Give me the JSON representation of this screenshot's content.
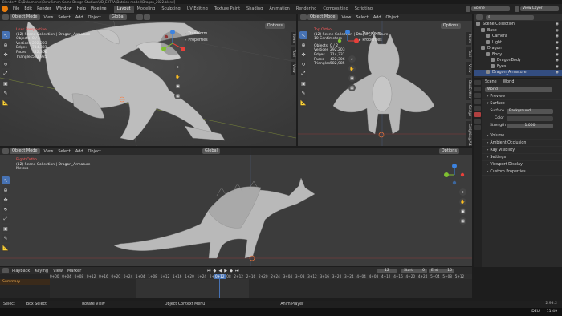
{
  "titlebar": {
    "title": "Blender* [E:\\Dokumente\\Beruflichen Game Design Studium\\3D_EXTRA\\Dateien modell\\Dragon_2022.blend]"
  },
  "topbar": {
    "menus": [
      "File",
      "Edit",
      "Render",
      "Window",
      "Help"
    ],
    "pipeline": "Pipeline",
    "workspaces": [
      "Layout",
      "Modeling",
      "Sculpting",
      "UV Editing",
      "Texture Paint",
      "Shading",
      "Animation",
      "Rendering",
      "Compositing",
      "Scripting"
    ],
    "active_workspace": "Layout",
    "scene_label": "Scene",
    "viewlayer_label": "View Layer"
  },
  "vp_top_left": {
    "mode": "Object Mode",
    "menus": [
      "View",
      "Select",
      "Add",
      "Object"
    ],
    "orientation": "Global",
    "overlay_title": "User Perspective",
    "overlay_collection": "(12) Scene Collection | Dragon_Armature",
    "stats": [
      {
        "label": "Objects",
        "value": "0 / 2"
      },
      {
        "label": "Vertices",
        "value": "292,203"
      },
      {
        "label": "Edges",
        "value": "714,331"
      },
      {
        "label": "Faces",
        "value": "422,306"
      },
      {
        "label": "Triangles",
        "value": "582,985"
      }
    ],
    "popover": [
      "Transform",
      "Properties"
    ],
    "options": "Options",
    "side_tabs": [
      "Item",
      "Tool",
      "View"
    ]
  },
  "vp_top_right": {
    "mode": "Object Mode",
    "menus": [
      "View",
      "Select",
      "Add",
      "Object"
    ],
    "orientation": "Global",
    "overlay_title": "Top Ortho",
    "overlay_collection": "(12) Scene Collection | Dragon_Armature",
    "overlay_extra": "10 Centimeters",
    "stats": [
      {
        "label": "Objects",
        "value": "0 / 2"
      },
      {
        "label": "Vertices",
        "value": "292,203"
      },
      {
        "label": "Edges",
        "value": "714,331"
      },
      {
        "label": "Faces",
        "value": "422,306"
      },
      {
        "label": "Triangles",
        "value": "582,985"
      }
    ],
    "popover": [
      "Transform",
      "Properties"
    ],
    "options": "Options",
    "side_tabs": [
      "Item",
      "Tool",
      "View",
      "BoxCutter",
      "Sculpt",
      "Scripting Addons"
    ]
  },
  "vp_bottom": {
    "mode": "Object Mode",
    "menus": [
      "View",
      "Select",
      "Add",
      "Object"
    ],
    "orientation": "Global",
    "overlay_title": "Right Ortho",
    "overlay_collection": "(12) Scene Collection | Dragon_Armature",
    "overlay_extra": "Meters",
    "options": "Options"
  },
  "outliner": {
    "rows": [
      {
        "label": "Scene Collection",
        "depth": 0,
        "selected": false
      },
      {
        "label": "Base",
        "depth": 1,
        "selected": false
      },
      {
        "label": "Camera",
        "depth": 2,
        "selected": false
      },
      {
        "label": "Light",
        "depth": 2,
        "selected": false
      },
      {
        "label": "Dragon",
        "depth": 1,
        "selected": false
      },
      {
        "label": "Body",
        "depth": 2,
        "selected": false
      },
      {
        "label": "DragonBody",
        "depth": 3,
        "selected": false
      },
      {
        "label": "Eyes",
        "depth": 3,
        "selected": false
      },
      {
        "label": "Dragon_Armature",
        "depth": 2,
        "selected": true
      }
    ]
  },
  "properties": {
    "header_scene": "Scene",
    "header_world": "World",
    "world_field": "World",
    "sections": [
      {
        "label": "Preview",
        "open": false
      },
      {
        "label": "Surface",
        "open": true
      }
    ],
    "surface_label": "Surface",
    "surface_value": "Background",
    "color_label": "Color",
    "strength_label": "Strength",
    "strength_value": "1.000",
    "sections_after": [
      "Volume",
      "Ambient Occlusion",
      "Ray Visibility",
      "Settings",
      "Viewport Display",
      "Custom Properties"
    ]
  },
  "timeline": {
    "menus": [
      "Playback",
      "Keying",
      "View",
      "Marker"
    ],
    "current_frame": "12",
    "start_label": "Start",
    "start_value": "0",
    "end_label": "End",
    "end_value": "15",
    "track_label": "Summary",
    "ruler": [
      "0+00",
      "0+04",
      "0+08",
      "0+12",
      "0+16",
      "0+20",
      "0+24",
      "1+04",
      "1+08",
      "1+12",
      "1+16",
      "1+20",
      "1+24",
      "2+04",
      "2+08",
      "2+12",
      "2+16",
      "2+20",
      "2+24",
      "3+04",
      "3+08",
      "3+12",
      "3+16",
      "3+20",
      "3+24",
      "4+04",
      "4+08",
      "4+12",
      "4+16",
      "4+20",
      "4+24",
      "5+04",
      "5+08",
      "5+12"
    ],
    "playhead_label": "0+12"
  },
  "statusbar": {
    "items": [
      "Select",
      "Box Select",
      "Rotate View",
      "Object Context Menu",
      "Anim Player"
    ],
    "version": "2.93.2",
    "tray": {
      "lang": "DEU",
      "time": "11:49"
    }
  },
  "colors": {
    "accent": "#4772b3",
    "selected_row": "#334d80",
    "axis_x": "#e8403a",
    "axis_y": "#7fc031",
    "axis_z": "#3c83e0",
    "playhead": "#4772b3"
  }
}
